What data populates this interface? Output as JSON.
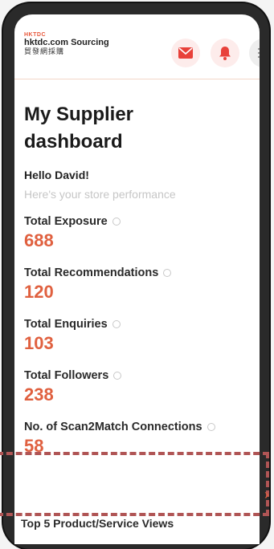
{
  "header": {
    "brand": "HKTDC",
    "site_name": "hktdc.com Sourcing",
    "site_name_cn": "貿發網採購",
    "icons": [
      "mail-icon",
      "bell-icon",
      "menu-icon"
    ],
    "accent_color": "#e0603f"
  },
  "page": {
    "title_line1": "My Supplier",
    "title_line2": "dashboard",
    "greeting": "Hello David!",
    "subtitle": "Here's your store performance"
  },
  "metrics": [
    {
      "label": "Total Exposure",
      "value": "688"
    },
    {
      "label": "Total Recommendations",
      "value": "120"
    },
    {
      "label": "Total Enquiries",
      "value": "103"
    },
    {
      "label": "Total Followers",
      "value": "238"
    },
    {
      "label": "No. of Scan2Match Connections",
      "value": "58"
    }
  ],
  "next_section": {
    "label": "Top 5 Product/Service Views"
  }
}
